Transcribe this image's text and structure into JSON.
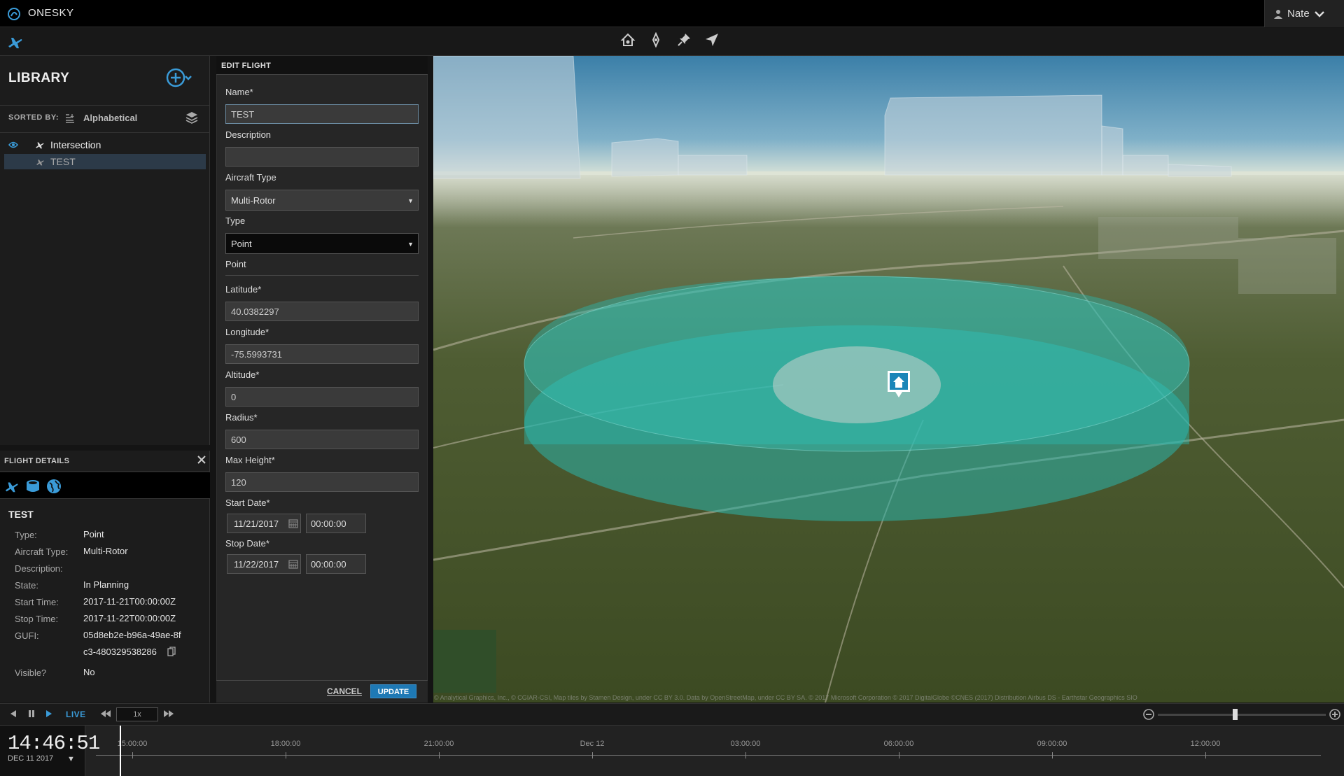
{
  "app": {
    "title": "ONESKY"
  },
  "user": {
    "name": "Nate"
  },
  "library": {
    "title": "LIBRARY",
    "sorted_by_label": "SORTED BY:",
    "sorted_by_value": "Alphabetical",
    "items": [
      {
        "label": "Intersection",
        "visible": true,
        "selected": false
      },
      {
        "label": "TEST",
        "visible": false,
        "selected": true
      }
    ]
  },
  "flight_details": {
    "title": "FLIGHT DETAILS",
    "name": "TEST",
    "rows": [
      {
        "label": "Type:",
        "value": "Point"
      },
      {
        "label": "Aircraft Type:",
        "value": "Multi-Rotor"
      },
      {
        "label": "Description:",
        "value": ""
      },
      {
        "label": "State:",
        "value": "In Planning"
      },
      {
        "label": "Start Time:",
        "value": "2017-11-21T00:00:00Z"
      },
      {
        "label": "Stop Time:",
        "value": "2017-11-22T00:00:00Z"
      },
      {
        "label": "GUFI:",
        "value": "05d8eb2e-b96a-49ae-8fc3-480329538286"
      },
      {
        "label": "Visible?",
        "value": "No"
      }
    ]
  },
  "edit_flight": {
    "title": "EDIT FLIGHT",
    "name_label": "Name*",
    "name_value": "TEST",
    "description_label": "Description",
    "description_value": "",
    "aircraft_type_label": "Aircraft Type",
    "aircraft_type_value": "Multi-Rotor",
    "type_label": "Type",
    "type_value": "Point",
    "section_label": "Point",
    "latitude_label": "Latitude*",
    "latitude_value": "40.0382297",
    "longitude_label": "Longitude*",
    "longitude_value": "-75.5993731",
    "altitude_label": "Altitude*",
    "altitude_value": "0",
    "radius_label": "Radius*",
    "radius_value": "600",
    "max_height_label": "Max Height*",
    "max_height_value": "120",
    "start_date_label": "Start Date*",
    "start_date_value": "11/21/2017",
    "start_time_value": "00:00:00",
    "stop_date_label": "Stop Date*",
    "stop_date_value": "11/22/2017",
    "stop_time_value": "00:00:00",
    "cancel_label": "CANCEL",
    "update_label": "UPDATE"
  },
  "map": {
    "attribution": "© Analytical Graphics, Inc., © CGIAR-CSI, Map tiles by Stamen Design, under CC BY 3.0. Data by OpenStreetMap, under CC BY SA. © 2017 Microsoft Corporation © 2017 DigitalGlobe ©CNES (2017) Distribution Airbus DS - Earthstar Geographics SIO",
    "zone_color": "#2bb5ac"
  },
  "timeline": {
    "live_label": "LIVE",
    "speed": "1x",
    "clock_time": "14:46:51",
    "clock_date": "DEC 11 2017",
    "ticks": [
      "15:00:00",
      "18:00:00",
      "21:00:00",
      "Dec 12",
      "03:00:00",
      "06:00:00",
      "09:00:00",
      "12:00:00"
    ]
  },
  "colors": {
    "accent": "#3a9bd8",
    "update_button": "#1e79b5"
  }
}
